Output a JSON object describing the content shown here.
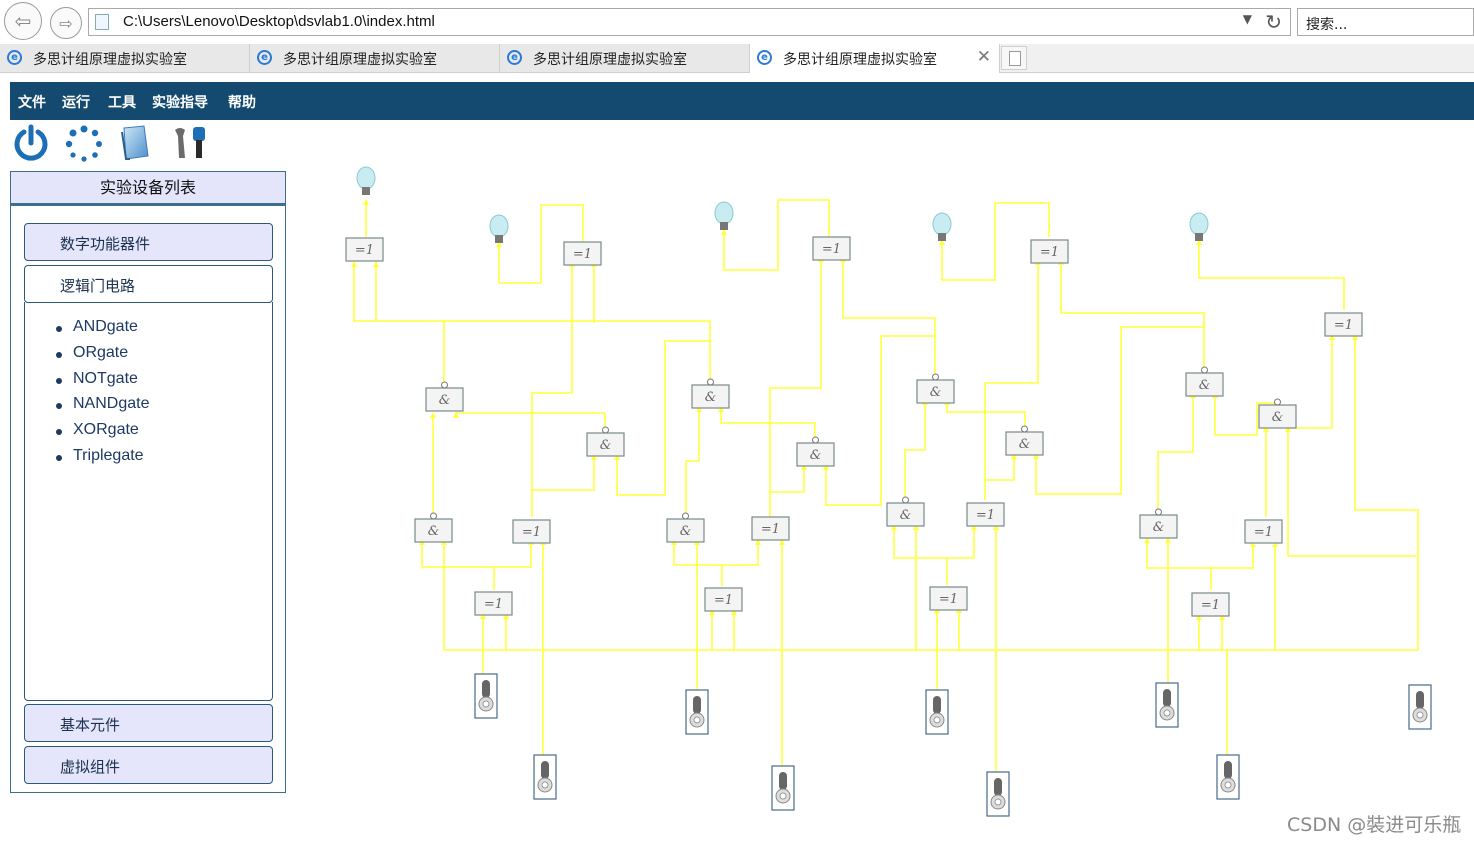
{
  "browser": {
    "url": "C:\\Users\\Lenovo\\Desktop\\dsvlab1.0\\index.html",
    "search_placeholder": "搜索...",
    "tabs": [
      {
        "label": "多思计组原理虚拟实验室",
        "active": false
      },
      {
        "label": "多思计组原理虚拟实验室",
        "active": false
      },
      {
        "label": "多思计组原理虚拟实验室",
        "active": false
      },
      {
        "label": "多思计组原理虚拟实验室",
        "active": true
      }
    ],
    "close_glyph": "✕"
  },
  "menu": [
    "文件",
    "运行",
    "工具",
    "实验指导",
    "帮助"
  ],
  "toolbar": [
    "power-icon",
    "loading-icon",
    "document-icon",
    "tools-icon"
  ],
  "sidebar": {
    "title": "实验设备列表",
    "sections": [
      "数字功能器件",
      "逻辑门电路",
      "基本元件",
      "虚拟组件"
    ],
    "open_section": "逻辑门电路",
    "logic_items": [
      "ANDgate",
      "ORgate",
      "NOTgate",
      "NANDgate",
      "XORgate",
      "Triplegate"
    ]
  },
  "circuit": {
    "and_label": "&",
    "xor_label": "=1",
    "wire_color": "#ffff3a",
    "gate_border": "#7a8a8a"
  },
  "watermark": "CSDN @裝进可乐瓶"
}
